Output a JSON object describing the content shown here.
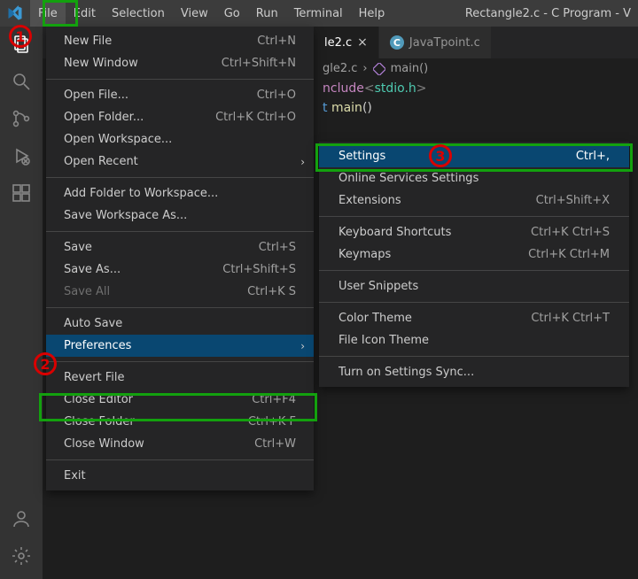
{
  "title": "Rectangle2.c - C Program - V",
  "menu": [
    "File",
    "Edit",
    "Selection",
    "View",
    "Go",
    "Run",
    "Terminal",
    "Help"
  ],
  "tabs": [
    {
      "label": "le2.c",
      "active": true
    },
    {
      "label": "JavaTpoint.c",
      "active": false
    }
  ],
  "breadcrumb": {
    "file": "gle2.c",
    "symbol": "main()"
  },
  "code": {
    "line1_kw": "nclude",
    "line1_open": "<",
    "line1_hdr": "stdio.h",
    "line1_close": ">",
    "line2_type": "t",
    "line2_fn": "main",
    "line2_paren": "()"
  },
  "file_menu": {
    "groups": [
      [
        {
          "label": "New File",
          "shortcut": "Ctrl+N"
        },
        {
          "label": "New Window",
          "shortcut": "Ctrl+Shift+N"
        }
      ],
      [
        {
          "label": "Open File...",
          "shortcut": "Ctrl+O"
        },
        {
          "label": "Open Folder...",
          "shortcut": "Ctrl+K Ctrl+O"
        },
        {
          "label": "Open Workspace...",
          "shortcut": ""
        },
        {
          "label": "Open Recent",
          "shortcut": "",
          "submenu": true
        }
      ],
      [
        {
          "label": "Add Folder to Workspace...",
          "shortcut": ""
        },
        {
          "label": "Save Workspace As...",
          "shortcut": ""
        }
      ],
      [
        {
          "label": "Save",
          "shortcut": "Ctrl+S"
        },
        {
          "label": "Save As...",
          "shortcut": "Ctrl+Shift+S"
        },
        {
          "label": "Save All",
          "shortcut": "Ctrl+K S",
          "disabled": true
        }
      ],
      [
        {
          "label": "Auto Save",
          "shortcut": ""
        },
        {
          "label": "Preferences",
          "shortcut": "",
          "submenu": true,
          "highlight": true
        }
      ],
      [
        {
          "label": "Revert File",
          "shortcut": ""
        },
        {
          "label": "Close Editor",
          "shortcut": "Ctrl+F4"
        },
        {
          "label": "Close Folder",
          "shortcut": "Ctrl+K F"
        },
        {
          "label": "Close Window",
          "shortcut": "Ctrl+W"
        }
      ],
      [
        {
          "label": "Exit",
          "shortcut": ""
        }
      ]
    ]
  },
  "preferences_submenu": {
    "groups": [
      [
        {
          "label": "Settings",
          "shortcut": "Ctrl+,",
          "highlight": true
        },
        {
          "label": "Online Services Settings",
          "shortcut": ""
        },
        {
          "label": "Extensions",
          "shortcut": "Ctrl+Shift+X"
        }
      ],
      [
        {
          "label": "Keyboard Shortcuts",
          "shortcut": "Ctrl+K Ctrl+S"
        },
        {
          "label": "Keymaps",
          "shortcut": "Ctrl+K Ctrl+M"
        }
      ],
      [
        {
          "label": "User Snippets",
          "shortcut": ""
        }
      ],
      [
        {
          "label": "Color Theme",
          "shortcut": "Ctrl+K Ctrl+T"
        },
        {
          "label": "File Icon Theme",
          "shortcut": ""
        }
      ],
      [
        {
          "label": "Turn on Settings Sync...",
          "shortcut": ""
        }
      ]
    ]
  },
  "callouts": {
    "one": "1",
    "two": "2",
    "three": "3"
  }
}
